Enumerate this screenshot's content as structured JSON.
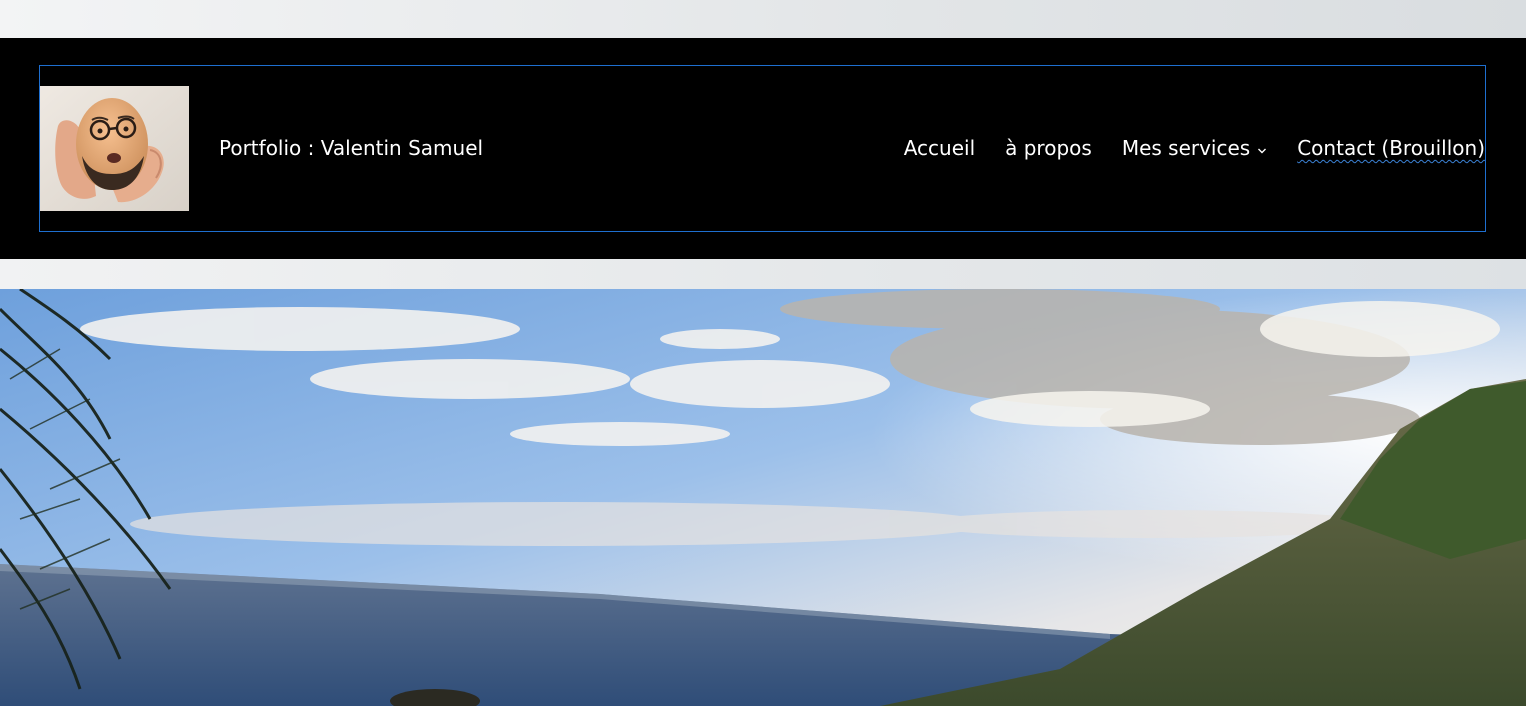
{
  "site": {
    "title": "Portfolio : Valentin Samuel"
  },
  "nav": {
    "items": [
      {
        "label": "Accueil"
      },
      {
        "label": "à propos"
      },
      {
        "label": "Mes services"
      },
      {
        "label": "Contact (Brouillon)"
      }
    ]
  },
  "icons": {
    "dropdown": "chevron-down-icon"
  },
  "colors": {
    "header_bg": "#000000",
    "header_text": "#ffffff",
    "focus_outline": "#1e6fd0",
    "spellcheck_underline": "#3b82d6"
  }
}
